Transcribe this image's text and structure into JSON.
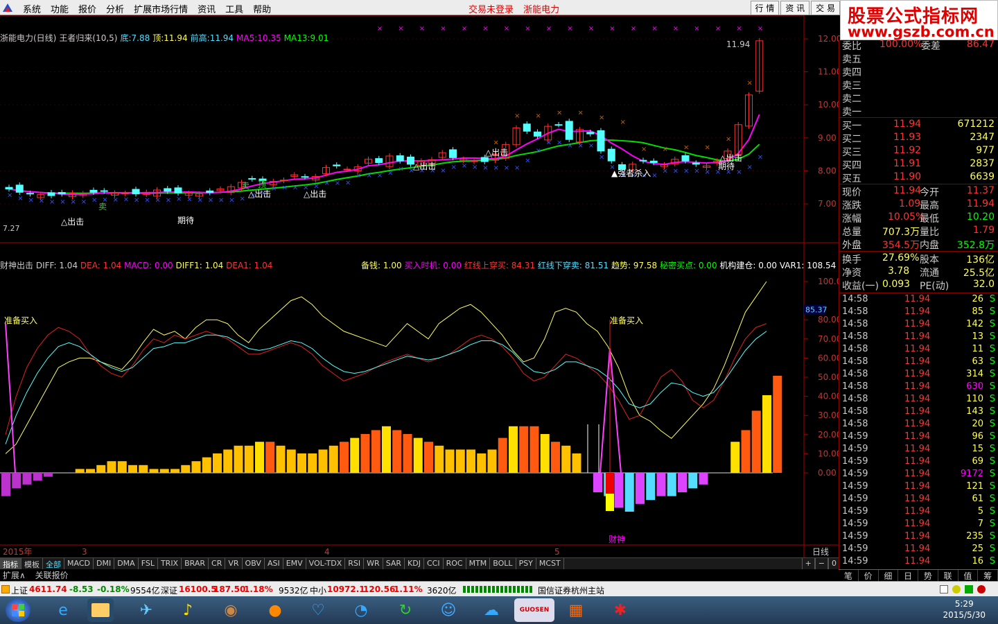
{
  "menubar": {
    "items": [
      "系统",
      "功能",
      "报价",
      "分析",
      "扩展市场行情",
      "资讯",
      "工具",
      "帮助"
    ],
    "login_status": "交易未登录",
    "stock_name": "浙能电力",
    "right_buttons": [
      "行 情",
      "资 讯",
      "交 易"
    ]
  },
  "brand": {
    "title": "股票公式指标网",
    "url": "www.gszb.com.cn"
  },
  "price_info": {
    "title": "浙能电力(日线)",
    "indicator": "王者归来(10,5)",
    "low_label": "底:",
    "low_value": "7.88",
    "high_label": "顶:",
    "high_value": "11.94",
    "prev_high_label": "前高:",
    "prev_high_value": "11.94",
    "ma5_label": "MA5:",
    "ma5_value": "10.35",
    "ma13_label": "MA13:",
    "ma13_value": "9.01"
  },
  "price_axis": [
    "12.00",
    "11.00",
    "10.00",
    "9.00",
    "8.00",
    "7.00"
  ],
  "indicator_info": {
    "name": "财神出击",
    "diff": "DIFF: 1.04",
    "dea": "DEA: 1.04",
    "macd": "MACD: 0.00",
    "diff1": "DIFF1: 1.04",
    "dea1": "DEA1: 1.04",
    "beiqian": "备钱: 1.00",
    "mairu": "买入时机: 0.00",
    "hongxian_up": "红线上穿买: 84.31",
    "hongxian_down": "红线下穿卖: 81.51",
    "qushi": "趋势: 97.58",
    "mimi": "秘密买点: 0.00",
    "jigou": "机构建仓: 0.00",
    "var1": "VAR1: 108.54"
  },
  "indicator_axis": [
    "100.0",
    "80.00",
    "70.00",
    "60.00",
    "50.00",
    "40.00",
    "30.00",
    "20.00",
    "10.00",
    "0.00"
  ],
  "current_value_badge": "85.37",
  "annotations": {
    "chu_ji": "△出击",
    "qi_dai": "期待",
    "mai": "卖",
    "ding": "顶",
    "qiang_zhe": "强者杀入",
    "zhun_bei": "准备买入",
    "cai_shen": "财神",
    "peak_price": "11.94",
    "low_price": "7.27"
  },
  "date_axis": {
    "year": "2015年",
    "m3": "3",
    "m4": "4",
    "m5": "5",
    "period": "日线"
  },
  "tabs": [
    "指标",
    "模板",
    "全部",
    "MACD",
    "DMI",
    "DMA",
    "FSL",
    "TRIX",
    "BRAR",
    "CR",
    "VR",
    "OBV",
    "ASI",
    "EMV",
    "VOL-TDX",
    "RSI",
    "WR",
    "SAR",
    "KDJ",
    "CCI",
    "ROC",
    "MTM",
    "BOLL",
    "PSY",
    "MCST"
  ],
  "tab_ctrl": [
    "+",
    "−",
    "0"
  ],
  "subtabs": [
    "扩展∧",
    "关联报价"
  ],
  "orderbook": {
    "wei_bi": "委比",
    "wei_bi_val": "100.00%",
    "wei_cha": "委差",
    "wei_cha_val": "86.47",
    "sell": [
      {
        "label": "卖五"
      },
      {
        "label": "卖四"
      },
      {
        "label": "卖三"
      },
      {
        "label": "卖二"
      },
      {
        "label": "卖一"
      }
    ],
    "buy": [
      {
        "label": "买一",
        "price": "11.94",
        "vol": "671212"
      },
      {
        "label": "买二",
        "price": "11.93",
        "vol": "2347"
      },
      {
        "label": "买三",
        "price": "11.92",
        "vol": "977"
      },
      {
        "label": "买四",
        "price": "11.91",
        "vol": "2837"
      },
      {
        "label": "买五",
        "price": "11.90",
        "vol": "6639"
      }
    ]
  },
  "quote": [
    {
      "l1": "现价",
      "v1": "11.94",
      "l2": "今开",
      "v2": "11.37"
    },
    {
      "l1": "涨跌",
      "v1": "1.09",
      "l2": "最高",
      "v2": "11.94"
    },
    {
      "l1": "涨幅",
      "v1": "10.05%",
      "l2": "最低",
      "v2": "10.20"
    },
    {
      "l1": "总量",
      "v1": "707.3万",
      "l2": "量比",
      "v2": "1.79"
    },
    {
      "l1": "外盘",
      "v1": "354.5万",
      "l2": "内盘",
      "v2": "352.8万"
    },
    {
      "l1": "换手",
      "v1": "27.69%",
      "l2": "股本",
      "v2": "136亿"
    },
    {
      "l1": "净资",
      "v1": "3.78",
      "l2": "流通",
      "v2": "25.5亿"
    },
    {
      "l1": "收益(一)",
      "v1": "0.093",
      "l2": "PE(动)",
      "v2": "32.0"
    }
  ],
  "ticks": [
    {
      "t": "14:58",
      "p": "11.94",
      "v": "26",
      "s": "S"
    },
    {
      "t": "14:58",
      "p": "11.94",
      "v": "85",
      "s": "S"
    },
    {
      "t": "14:58",
      "p": "11.94",
      "v": "142",
      "s": "S"
    },
    {
      "t": "14:58",
      "p": "11.94",
      "v": "13",
      "s": "S"
    },
    {
      "t": "14:58",
      "p": "11.94",
      "v": "11",
      "s": "S"
    },
    {
      "t": "14:58",
      "p": "11.94",
      "v": "63",
      "s": "S"
    },
    {
      "t": "14:58",
      "p": "11.94",
      "v": "314",
      "s": "S"
    },
    {
      "t": "14:58",
      "p": "11.94",
      "v": "630",
      "s": "S"
    },
    {
      "t": "14:58",
      "p": "11.94",
      "v": "110",
      "s": "S"
    },
    {
      "t": "14:58",
      "p": "11.94",
      "v": "143",
      "s": "S"
    },
    {
      "t": "14:58",
      "p": "11.94",
      "v": "20",
      "s": "S"
    },
    {
      "t": "14:59",
      "p": "11.94",
      "v": "96",
      "s": "S"
    },
    {
      "t": "14:59",
      "p": "11.94",
      "v": "15",
      "s": "S"
    },
    {
      "t": "14:59",
      "p": "11.94",
      "v": "69",
      "s": "S"
    },
    {
      "t": "14:59",
      "p": "11.94",
      "v": "9172",
      "s": "S"
    },
    {
      "t": "14:59",
      "p": "11.94",
      "v": "121",
      "s": "S"
    },
    {
      "t": "14:59",
      "p": "11.94",
      "v": "61",
      "s": "S"
    },
    {
      "t": "14:59",
      "p": "11.94",
      "v": "5",
      "s": "S"
    },
    {
      "t": "14:59",
      "p": "11.94",
      "v": "7",
      "s": "S"
    },
    {
      "t": "14:59",
      "p": "11.94",
      "v": "235",
      "s": "S"
    },
    {
      "t": "14:59",
      "p": "11.94",
      "v": "25",
      "s": "S"
    },
    {
      "t": "14:59",
      "p": "11.94",
      "v": "16",
      "s": "S"
    }
  ],
  "side_tabs": [
    "笔",
    "价",
    "细",
    "日",
    "势",
    "联",
    "值",
    "筹"
  ],
  "statusbar": {
    "sh_label": "上证",
    "sh_val": "4611.74",
    "sh_chg": "-8.53",
    "sh_pct": "-0.18%",
    "sh_amt": "9554亿",
    "sz_label": "深证",
    "sz_val": "16100.5",
    "sz_chg": "187.50",
    "sz_pct": "1.18%",
    "sz_amt": "9532亿",
    "zx_label": "中小",
    "zx_val": "10972.1",
    "zx_chg": "120.56",
    "zx_pct": "1.11%",
    "zx_amt": "3620亿",
    "broker": "国信证券杭州主站"
  },
  "clock": {
    "time": "5:29",
    "date": "2015/5/30"
  },
  "colors": {
    "up": "#ff3232",
    "down": "#54ffff",
    "ma5": "#ff00ff",
    "ma13": "#00ff00",
    "yellow": "#ffff00",
    "orange": "#ff5500"
  }
}
